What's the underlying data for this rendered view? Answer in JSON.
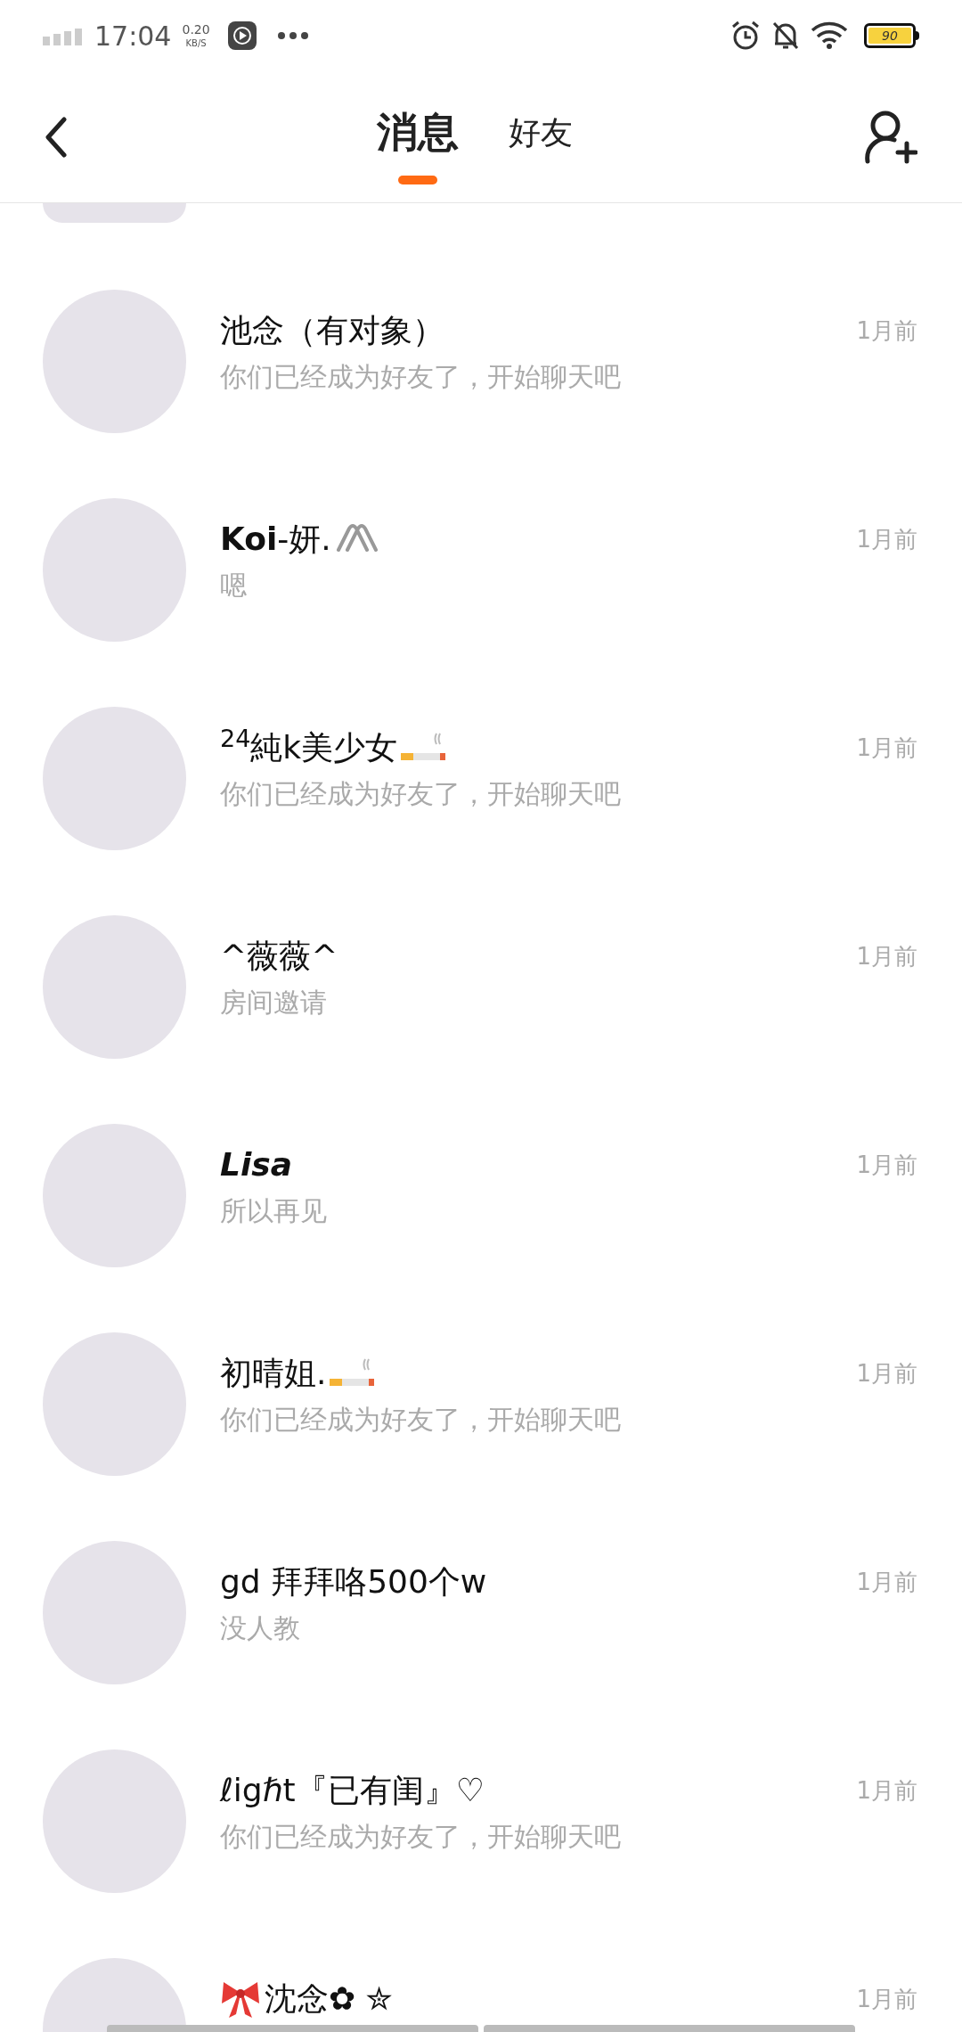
{
  "status_bar": {
    "time": "17:04",
    "speed_value": "0.20",
    "speed_unit": "KB/S",
    "battery": "90"
  },
  "tabs": [
    {
      "label": "消息",
      "selected": true
    },
    {
      "label": "好友",
      "selected": false
    }
  ],
  "chats": [
    {
      "kind": "plain",
      "name": "池念（有对象）",
      "preview": "你们已经成为好友了，开始聊天吧",
      "time": "1月前"
    },
    {
      "kind": "paperclip",
      "name": "**Koi**-妍.",
      "preview": "嗯",
      "time": "1月前"
    },
    {
      "kind": "cigarette",
      "name": "$^{24}$純k美少女",
      "preview": "你们已经成为好友了，开始聊天吧",
      "time": "1月前"
    },
    {
      "kind": "plain",
      "name": "^薇薇^",
      "preview": "房间邀请",
      "time": "1月前"
    },
    {
      "kind": "plain",
      "name": "Lisa",
      "bold": true,
      "preview": "所以再见",
      "time": "1月前"
    },
    {
      "kind": "cigarette",
      "name": "初晴姐.",
      "preview": "你们已经成为好友了，开始聊天吧",
      "time": "1月前"
    },
    {
      "kind": "plain",
      "name": "gd 拜拜咯500个w",
      "preview": "没人教",
      "time": "1月前"
    },
    {
      "kind": "plain",
      "name": "ℓigℏt『已有闺』♡",
      "preview": "你们已经成为好友了，开始聊天吧",
      "time": "1月前"
    },
    {
      "kind": "bow",
      "name": "沈念✿ ✮",
      "time": "1月前"
    }
  ]
}
